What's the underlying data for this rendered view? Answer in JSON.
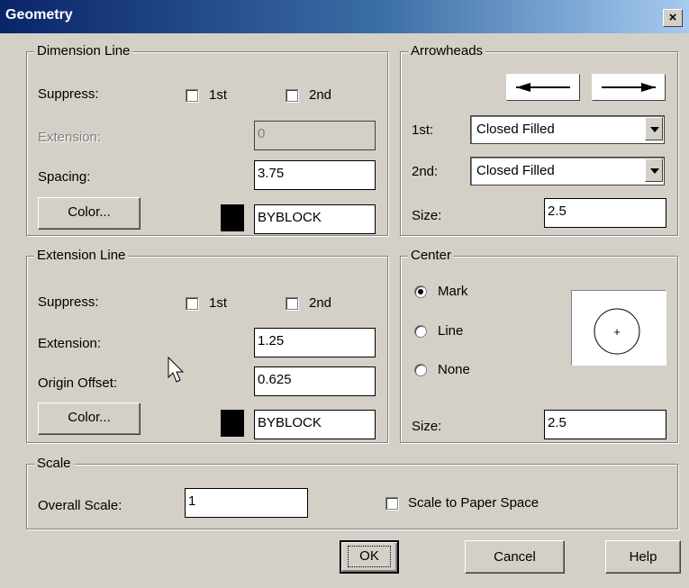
{
  "window": {
    "title": "Geometry",
    "close": "×"
  },
  "dimension_line": {
    "legend": "Dimension Line",
    "suppress_label": "Suppress:",
    "first_label": "1st",
    "second_label": "2nd",
    "extension_label": "Extension:",
    "extension_value": "0",
    "spacing_label": "Spacing:",
    "spacing_value": "3.75",
    "color_button": "Color...",
    "color_value": "BYBLOCK",
    "swatch_color": "#000000"
  },
  "arrowheads": {
    "legend": "Arrowheads",
    "first_label": "1st:",
    "first_value": "Closed Filled",
    "second_label": "2nd:",
    "second_value": "Closed Filled",
    "size_label": "Size:",
    "size_value": "2.5"
  },
  "extension_line": {
    "legend": "Extension Line",
    "suppress_label": "Suppress:",
    "first_label": "1st",
    "second_label": "2nd",
    "extension_label": "Extension:",
    "extension_value": "1.25",
    "origin_label": "Origin Offset:",
    "origin_value": "0.625",
    "color_button": "Color...",
    "color_value": "BYBLOCK",
    "swatch_color": "#000000"
  },
  "center": {
    "legend": "Center",
    "mark_label": "Mark",
    "line_label": "Line",
    "none_label": "None",
    "selected": "Mark",
    "size_label": "Size:",
    "size_value": "2.5",
    "preview_symbol": "+"
  },
  "scale": {
    "legend": "Scale",
    "overall_label": "Overall Scale:",
    "overall_value": "1",
    "paper_space_label": "Scale to Paper Space",
    "paper_space_checked": false
  },
  "buttons": {
    "ok": "OK",
    "cancel": "Cancel",
    "help": "Help"
  }
}
